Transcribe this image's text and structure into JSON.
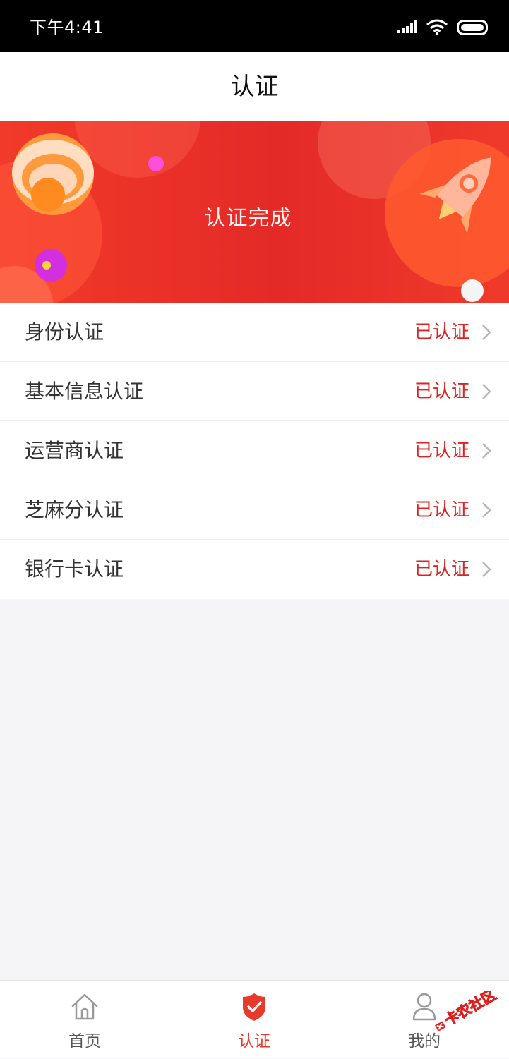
{
  "status_bar": {
    "time": "下午4:41"
  },
  "header": {
    "title": "认证"
  },
  "banner": {
    "title": "认证完成"
  },
  "verification_items": [
    {
      "label": "身份认证",
      "status": "已认证"
    },
    {
      "label": "基本信息认证",
      "status": "已认证"
    },
    {
      "label": "运营商认证",
      "status": "已认证"
    },
    {
      "label": "芝麻分认证",
      "status": "已认证"
    },
    {
      "label": "银行卡认证",
      "status": "已认证"
    }
  ],
  "tab_bar": {
    "tabs": [
      {
        "label": "首页",
        "icon": "home-icon",
        "active": false
      },
      {
        "label": "认证",
        "icon": "shield-check-icon",
        "active": true
      },
      {
        "label": "我的",
        "icon": "user-icon",
        "active": false
      }
    ]
  },
  "watermark": {
    "text": "卡农社区"
  },
  "colors": {
    "accent": "#e8392d",
    "status_text": "#dd2222",
    "background": "#f5f4f7"
  }
}
